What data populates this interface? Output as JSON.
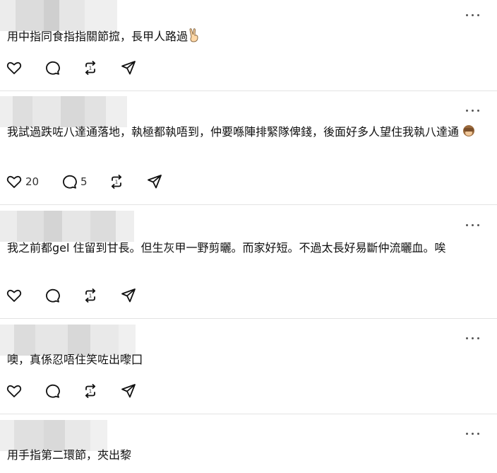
{
  "posts": [
    {
      "text": "用中指同食指指關節搲，長甲人路過",
      "emoji": "victory-hand-emoji",
      "likes": "",
      "replies": ""
    },
    {
      "text": "我試過跌咗八達通落地，執極都執唔到，仲要喺陣排緊隊俾錢，後面好多人望住我執八達通",
      "emoji": "see-no-evil-monkey-emoji",
      "likes": "20",
      "replies": "5"
    },
    {
      "text": "我之前都gel 住留到甘長。但生灰甲一野剪曬。而家好短。不過太長好易斷仲流曬血。唉",
      "emoji": "",
      "likes": "",
      "replies": ""
    },
    {
      "text": "噢，真係忍唔住笑咗出嚟囗",
      "emoji": "",
      "likes": "",
      "replies": ""
    },
    {
      "text": "用手指第二環節，夾出黎",
      "emoji": "",
      "likes": "",
      "replies": ""
    }
  ],
  "icons": {
    "like": "heart-icon",
    "reply": "comment-icon",
    "repost": "repost-icon",
    "share": "send-icon",
    "more": "more-options-icon"
  },
  "colors": {
    "icon": "#111111",
    "divider": "#e3e3e3",
    "muted": "#555555"
  }
}
